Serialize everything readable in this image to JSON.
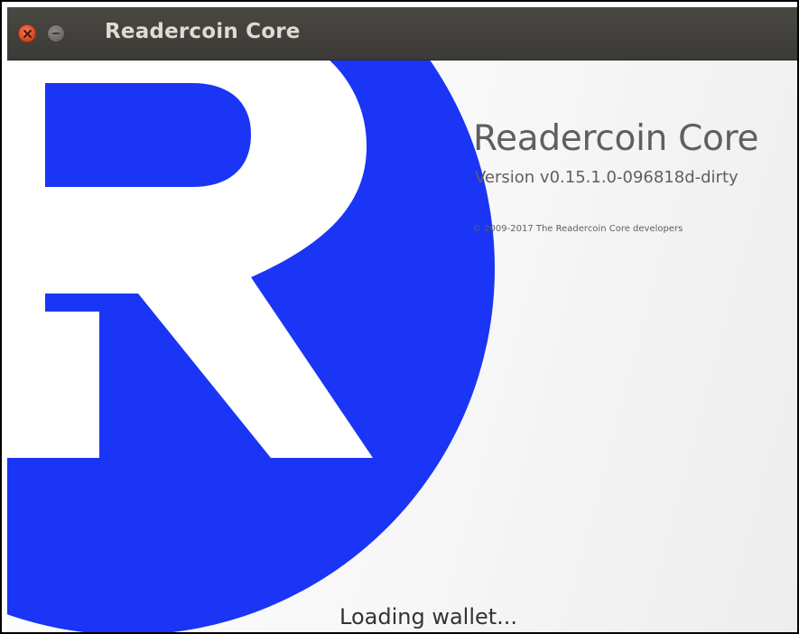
{
  "window": {
    "title": "Readercoin Core"
  },
  "splash": {
    "app_name": "Readercoin Core",
    "version": "Version v0.15.1.0-096818d-dirty",
    "copyright": "© 2009-2017 The Readercoin Core developers",
    "status": "Loading wallet..."
  },
  "icons": {
    "close": "close-icon",
    "minimize": "minimize-icon",
    "logo": "readercoin-logo"
  },
  "colors": {
    "logo_blue": "#1a35f5",
    "titlebar": "#3f3e3a",
    "text_grey": "#5f5f5f"
  }
}
